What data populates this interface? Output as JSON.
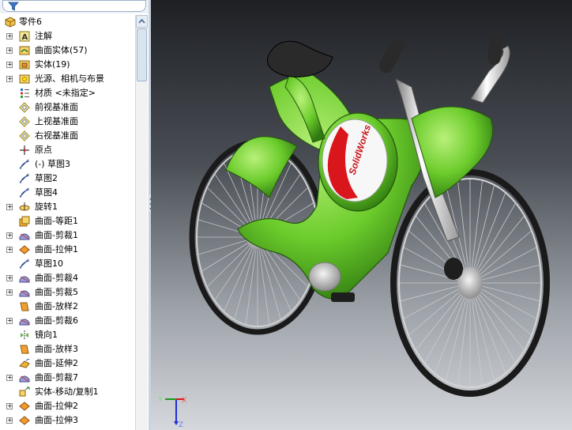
{
  "filter": {
    "icon": "filter-icon"
  },
  "tree": {
    "root": {
      "label": "零件6",
      "icon": "part-icon"
    },
    "items": [
      {
        "label": "注解",
        "icon": "annotation-icon",
        "expandable": true
      },
      {
        "label": "曲面实体(57)",
        "icon": "surface-bodies-icon",
        "expandable": true
      },
      {
        "label": "实体(19)",
        "icon": "solid-bodies-icon",
        "expandable": true
      },
      {
        "label": "光源、相机与布景",
        "icon": "lights-camera-icon",
        "expandable": true
      },
      {
        "label": "材质 <未指定>",
        "icon": "material-icon",
        "expandable": false
      },
      {
        "label": "前视基准面",
        "icon": "plane-icon",
        "expandable": false
      },
      {
        "label": "上视基准面",
        "icon": "plane-icon",
        "expandable": false
      },
      {
        "label": "右视基准面",
        "icon": "plane-icon",
        "expandable": false
      },
      {
        "label": "原点",
        "icon": "origin-icon",
        "expandable": false
      },
      {
        "label": "(-) 草图3",
        "icon": "sketch-icon",
        "expandable": false
      },
      {
        "label": "草图2",
        "icon": "sketch-icon",
        "expandable": false
      },
      {
        "label": "草图4",
        "icon": "sketch-icon",
        "expandable": false
      },
      {
        "label": "旋转1",
        "icon": "revolve-icon",
        "expandable": true
      },
      {
        "label": "曲面-等距1",
        "icon": "surface-offset-icon",
        "expandable": false
      },
      {
        "label": "曲面-剪裁1",
        "icon": "surface-trim-icon",
        "expandable": true
      },
      {
        "label": "曲面-拉伸1",
        "icon": "surface-extrude-icon",
        "expandable": true
      },
      {
        "label": "草图10",
        "icon": "sketch-icon",
        "expandable": false
      },
      {
        "label": "曲面-剪裁4",
        "icon": "surface-trim-icon",
        "expandable": true
      },
      {
        "label": "曲面-剪裁5",
        "icon": "surface-trim-icon",
        "expandable": true
      },
      {
        "label": "曲面-放样2",
        "icon": "surface-loft-icon",
        "expandable": false
      },
      {
        "label": "曲面-剪裁6",
        "icon": "surface-trim-icon",
        "expandable": true
      },
      {
        "label": "镜向1",
        "icon": "mirror-icon",
        "expandable": false
      },
      {
        "label": "曲面-放样3",
        "icon": "surface-loft-icon",
        "expandable": false
      },
      {
        "label": "曲面-延伸2",
        "icon": "surface-extend-icon",
        "expandable": false
      },
      {
        "label": "曲面-剪裁7",
        "icon": "surface-trim-icon",
        "expandable": true
      },
      {
        "label": "实体-移动/复制1",
        "icon": "move-copy-icon",
        "expandable": false
      },
      {
        "label": "曲面-拉伸2",
        "icon": "surface-extrude-icon",
        "expandable": true
      },
      {
        "label": "曲面-拉伸3",
        "icon": "surface-extrude-icon",
        "expandable": true
      }
    ]
  },
  "viewport": {
    "model": "bicycle-model",
    "logo_text": "SolidWorks",
    "triad": {
      "x": "X",
      "y": "Y",
      "z": "Z"
    }
  },
  "colors": {
    "bike_green": "#6ccc2c",
    "bike_dark_green": "#2f7a10",
    "viewport_top": "#1e2024",
    "viewport_bottom": "#d5d8dc"
  }
}
